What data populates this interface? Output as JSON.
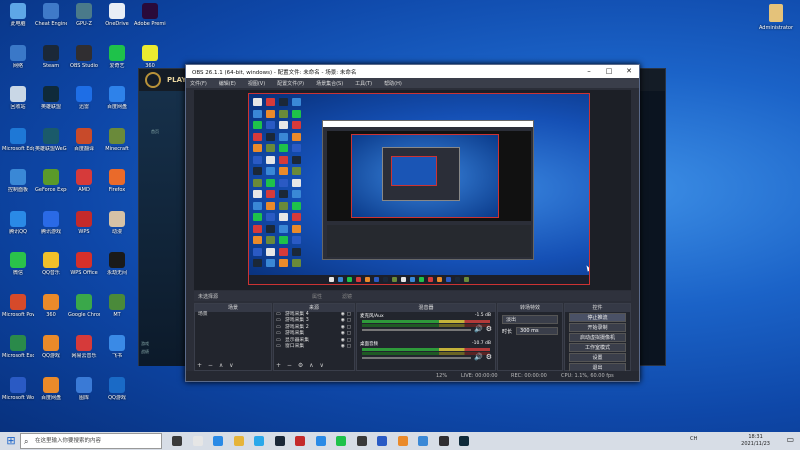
{
  "desktop_icons": [
    {
      "label": "此电脑",
      "color": "#5ea7e6"
    },
    {
      "label": "Cheat Engine",
      "color": "#3f7ac8"
    },
    {
      "label": "GPU-Z",
      "color": "#4a7a8a"
    },
    {
      "label": "OneDrive",
      "color": "#e8eef6"
    },
    {
      "label": "Adobe Premiere",
      "color": "#2a0a3a"
    },
    {
      "label": "网络",
      "color": "#3a78c8"
    },
    {
      "label": "Steam",
      "color": "#1b2838"
    },
    {
      "label": "OBS Studio",
      "color": "#302e31"
    },
    {
      "label": "爱奇艺",
      "color": "#1ec24a"
    },
    {
      "label": "360",
      "color": "#eaea30"
    },
    {
      "label": "回收站",
      "color": "#c9d7e6"
    },
    {
      "label": "英雄联盟",
      "color": "#0f2a3a"
    },
    {
      "label": "迅雷",
      "color": "#1e6ee6"
    },
    {
      "label": "百度网盘",
      "color": "#2e82ea"
    },
    {
      "label": "Microsoft Edge",
      "color": "#1e78d6"
    },
    {
      "label": "英雄联盟WeGame",
      "color": "#1a5a6a"
    },
    {
      "label": "百度翻译",
      "color": "#c84a2a"
    },
    {
      "label": "Minecraft",
      "color": "#6a8a3a"
    },
    {
      "label": "控制面板",
      "color": "#3a88d6"
    },
    {
      "label": "GeForce Experience",
      "color": "#5a9a2a"
    },
    {
      "label": "AMD",
      "color": "#d63a3a"
    },
    {
      "label": "Firefox",
      "color": "#ea6a2a"
    },
    {
      "label": "腾讯QQ",
      "color": "#2a8ae6"
    },
    {
      "label": "腾讯游戏",
      "color": "#2a6ae6"
    },
    {
      "label": "WPS",
      "color": "#c42a2a"
    },
    {
      "label": "动漫",
      "color": "#d6c2a6"
    },
    {
      "label": "微信",
      "color": "#2ac24a"
    },
    {
      "label": "QQ音乐",
      "color": "#f0c02a"
    },
    {
      "label": "WPS Office",
      "color": "#d6302a"
    },
    {
      "label": "永劫无间",
      "color": "#1a1a1a"
    },
    {
      "label": "Microsoft PowerPoint",
      "color": "#d64a2a"
    },
    {
      "label": "360",
      "color": "#ea8a2a"
    },
    {
      "label": "Google Chrome",
      "color": "#3aa84a"
    },
    {
      "label": "MT",
      "color": "#4a8a3a"
    },
    {
      "label": "Microsoft Excel",
      "color": "#2a8a4a"
    },
    {
      "label": "QQ游戏",
      "color": "#ea8a2a"
    },
    {
      "label": "网易云音乐",
      "color": "#d63a3a"
    },
    {
      "label": "飞书",
      "color": "#3a8ae6"
    },
    {
      "label": "Microsoft Word",
      "color": "#2a5ac4"
    },
    {
      "label": "百度网盘",
      "color": "#ea8a2a"
    },
    {
      "label": "图库",
      "color": "#3a7ad6"
    },
    {
      "label": "QQ游戏",
      "color": "#1a6ac6"
    }
  ],
  "admin_label": "Administrator",
  "lol": {
    "play": "PLAY",
    "side_text": "首页",
    "aux1": "游戏",
    "aux2": "战绩"
  },
  "obs": {
    "title": "OBS 26.1.1 (64-bit, windows) - 配置文件: 未命名 - 场景: 未命名",
    "menu": [
      "文件(F)",
      "编辑(E)",
      "视图(V)",
      "配置文件(P)",
      "场景集合(S)",
      "工具(T)",
      "帮助(H)"
    ],
    "strip": {
      "source_none": "未选择源",
      "props": "属性",
      "filters": "滤镜"
    },
    "panels": {
      "scenes": "场景",
      "sources": "来源",
      "mixer": "混音器",
      "transitions": "转场特效",
      "controls": "控件"
    },
    "scene_name": "场景",
    "sources": [
      "游戏采集 4",
      "游戏采集 3",
      "游戏采集 2",
      "游戏采集",
      "显示器采集",
      "窗口采集"
    ],
    "mixer": [
      {
        "name": "麦克风/Aux",
        "db": "-1.5 dB"
      },
      {
        "name": "桌面音频",
        "db": "-10.7 dB"
      }
    ],
    "transition": {
      "type": "淡出",
      "duration_label": "时长",
      "duration": "300 ms"
    },
    "controls": [
      "停止推流",
      "开始录制",
      "启动虚拟摄像机",
      "工作室模式",
      "设置",
      "退出"
    ],
    "status": {
      "live": "LIVE: 00:00:00",
      "rec": "REC: 00:00:00",
      "cpu": "CPU: 1.1%, 60.00 fps",
      "tl": "12%"
    }
  },
  "taskbar": {
    "search": "在这里输入你要搜索的内容",
    "time": "18:31",
    "date": "2021/11/23",
    "lang": "CH"
  }
}
